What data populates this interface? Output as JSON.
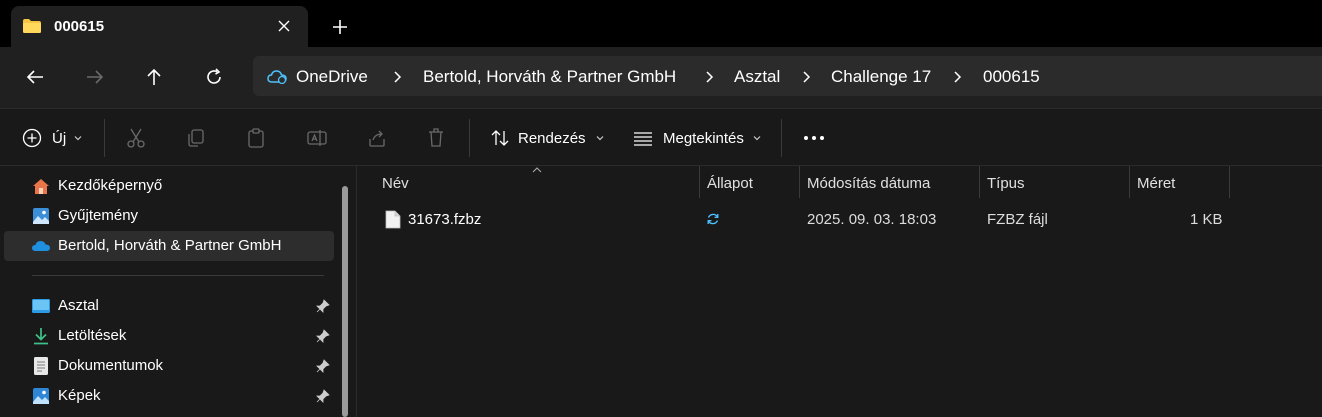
{
  "tab": {
    "title": "000615"
  },
  "address": {
    "crumbs": [
      "OneDrive",
      "Bertold, Horváth & Partner GmbH",
      "Asztal",
      "Challenge 17",
      "000615"
    ]
  },
  "commands": {
    "new_label": "Új",
    "sort_label": "Rendezés",
    "view_label": "Megtekintés"
  },
  "sidebar": {
    "items": [
      {
        "label": "Kezdőképernyő",
        "icon": "home-icon"
      },
      {
        "label": "Gyűjtemény",
        "icon": "gallery-icon"
      },
      {
        "label": "Bertold, Horváth & Partner GmbH",
        "icon": "onedrive-cloud-icon",
        "selected": true
      }
    ],
    "pinned": [
      {
        "label": "Asztal",
        "icon": "desktop-icon"
      },
      {
        "label": "Letöltések",
        "icon": "download-icon"
      },
      {
        "label": "Dokumentumok",
        "icon": "documents-icon"
      },
      {
        "label": "Képek",
        "icon": "pictures-icon"
      }
    ]
  },
  "table": {
    "columns": [
      "Név",
      "Állapot",
      "Módosítás dátuma",
      "Típus",
      "Méret"
    ],
    "rows": [
      {
        "name": "31673.fzbz",
        "status": "sync-icon",
        "modified": "2025. 09. 03. 18:03",
        "type": "FZBZ fájl",
        "size": "1 KB"
      }
    ]
  },
  "colors": {
    "accent": "#4cc2ff",
    "folder": "#f4c542",
    "background": "#191919"
  }
}
